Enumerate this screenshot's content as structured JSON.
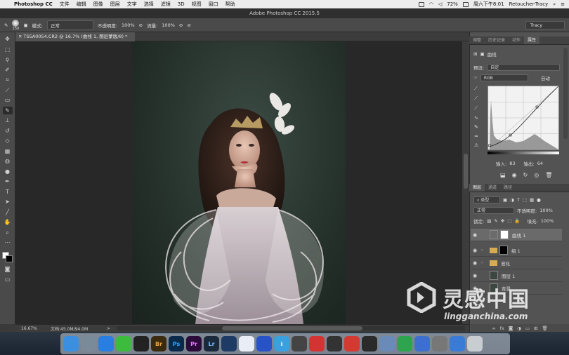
{
  "menubar": {
    "apple": "",
    "app_name": "Photoshop CC",
    "items": [
      "文件",
      "编辑",
      "图像",
      "图层",
      "文字",
      "选择",
      "滤镜",
      "3D",
      "视图",
      "窗口",
      "帮助"
    ],
    "battery": "72%",
    "clock": "周六下午8:01",
    "user": "Retoucher-Tracy"
  },
  "window": {
    "title": "Adobe Photoshop CC 2015.5"
  },
  "options": {
    "brush_size": "150",
    "mode_label": "模式:",
    "mode_value": "正常",
    "opacity_label": "不透明度:",
    "opacity_value": "100%",
    "flow_label": "流量:",
    "flow_value": "100%",
    "workspace": "Tracy"
  },
  "document": {
    "tab_label": "TS5A0054.CR2 @ 16.7% (曲线 1, 图层蒙版/8) *",
    "zoom": "16.67%",
    "doc_size": "文档:45.0M/94.0M",
    "status_arrow": ">"
  },
  "tools": [
    "move-tool",
    "marquee-tool",
    "lasso-tool",
    "quick-select-tool",
    "crop-tool",
    "eyedropper-tool",
    "healing-tool",
    "brush-tool",
    "clone-stamp-tool",
    "history-brush-tool",
    "eraser-tool",
    "gradient-tool",
    "blur-tool",
    "dodge-tool",
    "pen-tool",
    "type-tool",
    "path-select-tool",
    "shape-tool",
    "hand-tool",
    "zoom-tool",
    "more-tools"
  ],
  "props_panel": {
    "tabs": [
      "调整",
      "历史记录",
      "动作",
      "属性"
    ],
    "active_tab": 3,
    "title": "曲线",
    "preset_label": "预设:",
    "preset_value": "自定",
    "channel_value": "RGB",
    "auto_button": "自动",
    "input_label": "输入:",
    "input_value": "83",
    "output_label": "输出:",
    "output_value": "64"
  },
  "layers_panel": {
    "tabs": [
      "图层",
      "通道",
      "路径"
    ],
    "active_tab": 0,
    "kind_label": "类型",
    "blend_mode": "正常",
    "opacity_label": "不透明度:",
    "opacity_value": "100%",
    "lock_label": "锁定:",
    "fill_label": "填充:",
    "fill_value": "100%",
    "layers": [
      {
        "name": "曲线 1",
        "selected": true
      },
      {
        "name": "组 1",
        "selected": false
      },
      {
        "name": "液化",
        "selected": false
      },
      {
        "name": "图层 1",
        "selected": false
      },
      {
        "name": "背景",
        "selected": false
      }
    ]
  },
  "watermark": {
    "cn": "灵感中国",
    "en": "lingganchina.com"
  },
  "dock": {
    "apps": [
      {
        "name": "finder",
        "label": "",
        "color": "#3b8fe0"
      },
      {
        "name": "launchpad",
        "label": "",
        "color": "#7a8a99"
      },
      {
        "name": "safari",
        "label": "",
        "color": "#2a7de1"
      },
      {
        "name": "wechat",
        "label": "",
        "color": "#3dbb3d"
      },
      {
        "name": "qq",
        "label": "",
        "color": "#222222"
      },
      {
        "name": "bridge",
        "label": "Br",
        "color": "#3a2a10"
      },
      {
        "name": "photoshop",
        "label": "Ps",
        "color": "#0b2a4a"
      },
      {
        "name": "premiere",
        "label": "Pr",
        "color": "#2a0b3a"
      },
      {
        "name": "lightroom",
        "label": "Lr",
        "color": "#1a2a3a"
      },
      {
        "name": "cinema4d",
        "label": "",
        "color": "#1e3b66"
      },
      {
        "name": "baidu-netdisk",
        "label": "",
        "color": "#e9eef6"
      },
      {
        "name": "capture",
        "label": "",
        "color": "#2753c7"
      },
      {
        "name": "info",
        "label": "i",
        "color": "#3aa0e0"
      },
      {
        "name": "davinci",
        "label": "",
        "color": "#444444"
      },
      {
        "name": "record",
        "label": "",
        "color": "#d33333"
      },
      {
        "name": "obs",
        "label": "",
        "color": "#333333"
      },
      {
        "name": "netease-music",
        "label": "",
        "color": "#d33a31"
      },
      {
        "name": "quicktime",
        "label": "",
        "color": "#2a2a2a"
      },
      {
        "name": "preview",
        "label": "",
        "color": "#6a8ab8"
      },
      {
        "name": "numbers",
        "label": "",
        "color": "#2ea44f"
      },
      {
        "name": "keynote",
        "label": "",
        "color": "#3d6fd0"
      },
      {
        "name": "screen-sharing",
        "label": "",
        "color": "#777777"
      },
      {
        "name": "downloads",
        "label": "",
        "color": "#3a7bd5"
      },
      {
        "name": "trash",
        "label": "",
        "color": "#c8cdd2"
      }
    ]
  }
}
